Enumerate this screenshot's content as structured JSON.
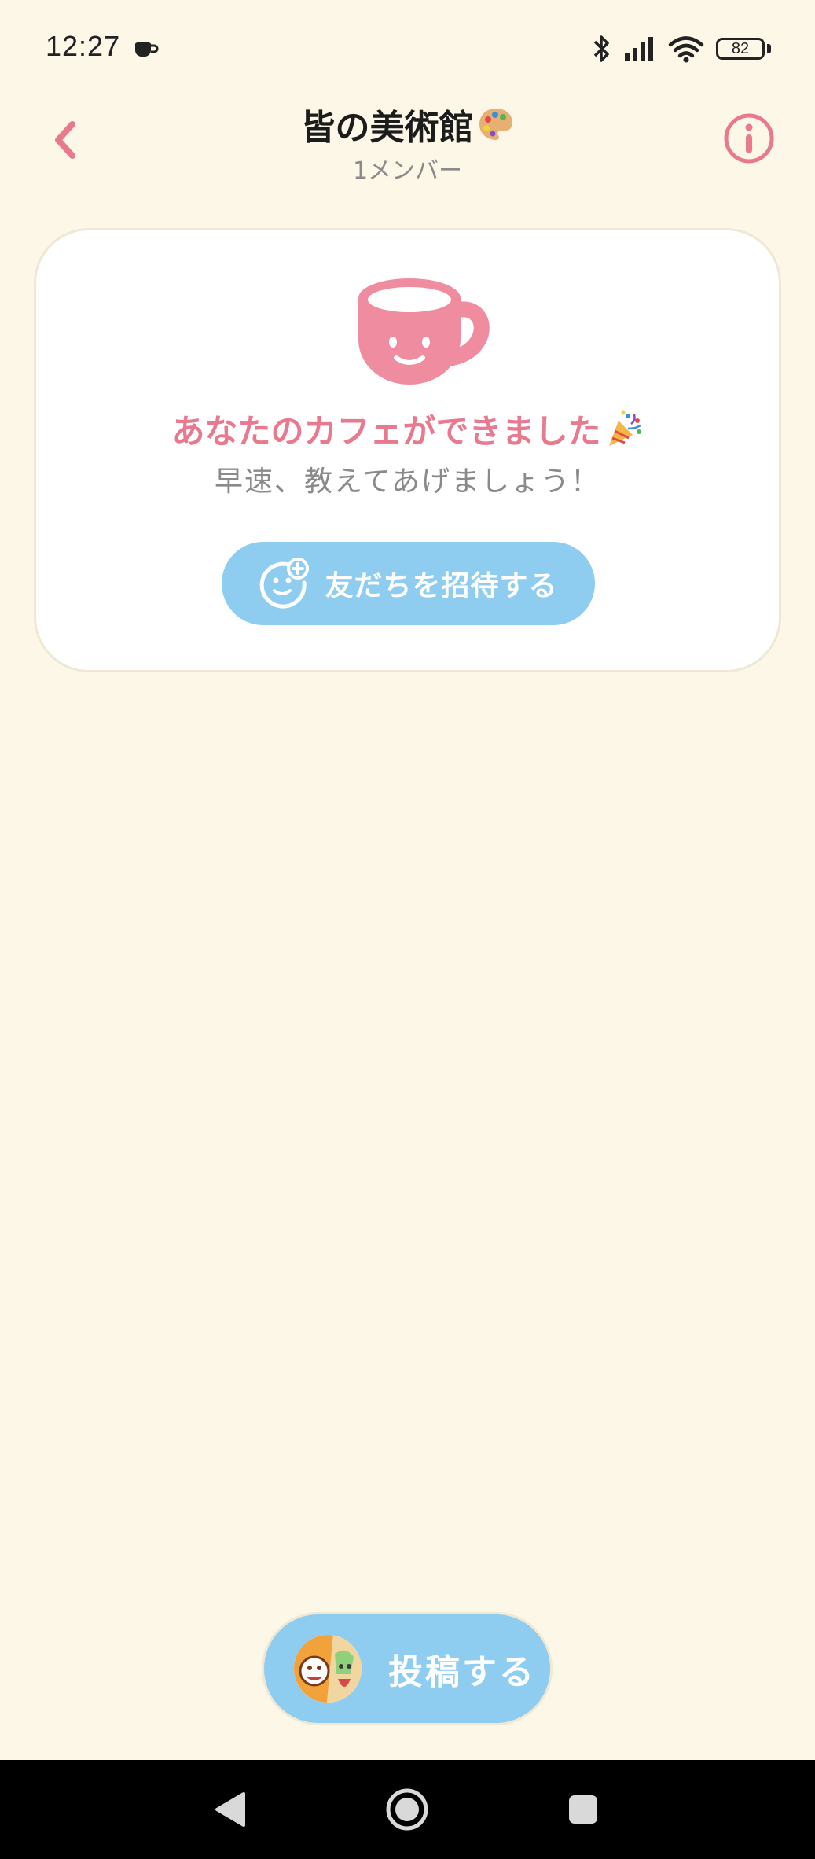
{
  "status_bar": {
    "time": "12:27",
    "battery_level": "82"
  },
  "header": {
    "title": "皆の美術館",
    "subtitle": "1メンバー"
  },
  "welcome_card": {
    "heading": "あなたのカフェができました",
    "subtext": "早速、教えてあげましょう！",
    "invite_button_label": "友だちを招待する"
  },
  "post_button": {
    "label": "投稿する"
  },
  "colors": {
    "background": "#fdf7e8",
    "accent_pink": "#e8798f",
    "accent_blue": "#8ecdf0",
    "text_gray": "#8a8a8a"
  },
  "icons": {
    "back": "chevron-left-icon",
    "info": "info-icon",
    "cup": "coffee-cup-icon",
    "invite": "add-friend-icon",
    "nav_back": "triangle-back-icon",
    "nav_home": "circle-home-icon",
    "nav_recents": "square-recents-icon"
  }
}
